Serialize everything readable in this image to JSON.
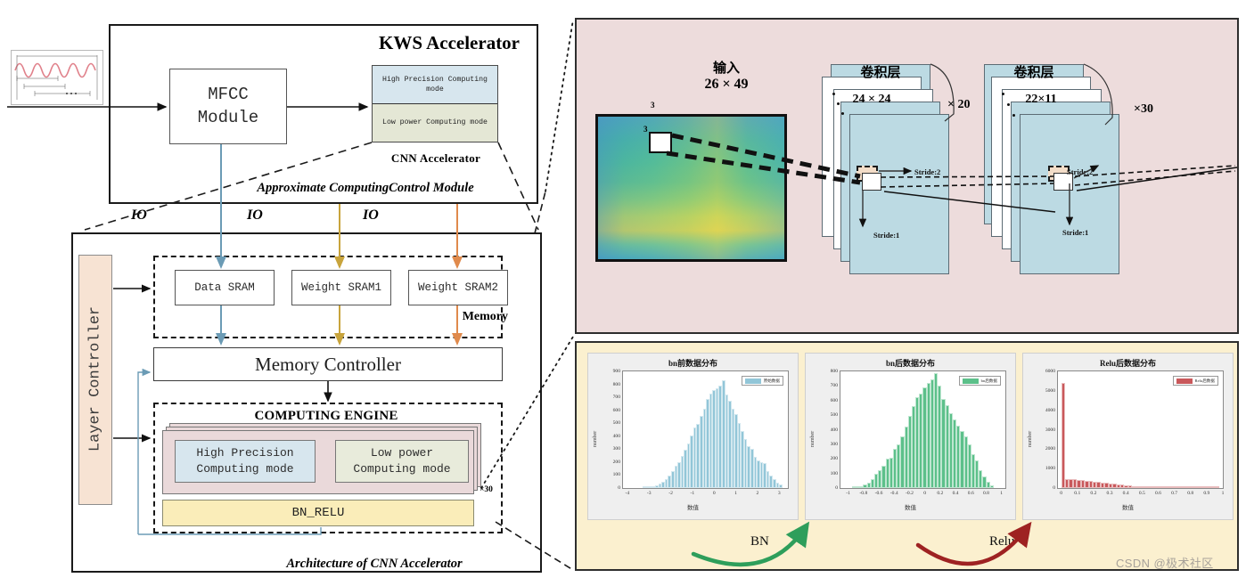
{
  "left_panel": {
    "kws_title": "KWS Accelerator",
    "mfcc_line1": "MFCC",
    "mfcc_line2": "Module",
    "cnn_high_precision": "High Precision Computing mode",
    "cnn_low_power": "Low power Computing mode",
    "cnn_accelerator_label": "CNN  Accelerator",
    "approx_label": "Approximate ComputingControl Module",
    "waveform_icon": "audio-waveform-framing-icon"
  },
  "io_labels": [
    "IO",
    "IO",
    "IO"
  ],
  "io_colors": [
    "#6b9bb5",
    "#c8a43c",
    "#e08a4c"
  ],
  "architecture": {
    "layer_controller": "Layer Controller",
    "memory_label": "Memory",
    "srams": [
      "Data SRAM",
      "Weight SRAM1",
      "Weight SRAM2"
    ],
    "memory_controller": "Memory Controller",
    "engine_title": "COMPUTING ENGINE",
    "mode_high_precision_l1": "High Precision",
    "mode_high_precision_l2": "Computing mode",
    "mode_low_power_l1": "Low power",
    "mode_low_power_l2": "Computing mode",
    "bn_relu": "BN_RELU",
    "engine_multiplier": "×30",
    "arch_label": "Architecture of CNN Accelerator"
  },
  "network": {
    "input_title": "输入",
    "input_dims": "26 × 49",
    "input_depth_top": "3",
    "input_depth_inner": "3",
    "conv1": {
      "title": "卷积层",
      "dims": "24 × 24",
      "stride_h": "Stride:2",
      "stride_v": "Stride:1",
      "multiplier": "× 20"
    },
    "conv2": {
      "title": "卷积层",
      "dims": "22×11",
      "stride_h": "Stride:2",
      "stride_v": "Stride:1",
      "multiplier": "×30"
    }
  },
  "transitions": {
    "bn": "BN",
    "relu": "Relu"
  },
  "watermark": "CSDN @极术社区",
  "chart_data": [
    {
      "type": "bar",
      "title": "bn前数据分布",
      "xlabel": "数值",
      "ylabel": "number",
      "ylim": [
        0,
        900
      ],
      "yticks": [
        0,
        100,
        200,
        300,
        400,
        500,
        600,
        700,
        800,
        900
      ],
      "xticks": [
        -4,
        -3,
        -2,
        -1,
        0,
        1,
        2,
        3
      ],
      "xlim": [
        -4.2,
        3.4
      ],
      "legend": [
        "原始数据"
      ],
      "color": "#92c6d8",
      "grid": false,
      "legend_position": "top-right",
      "categories": [
        -3.3,
        -3.15,
        -3.0,
        -2.85,
        -2.7,
        -2.55,
        -2.4,
        -2.25,
        -2.1,
        -1.95,
        -1.8,
        -1.65,
        -1.5,
        -1.35,
        -1.2,
        -1.05,
        -0.9,
        -0.75,
        -0.6,
        -0.45,
        -0.3,
        -0.15,
        0.0,
        0.15,
        0.3,
        0.45,
        0.6,
        0.75,
        0.9,
        1.05,
        1.2,
        1.35,
        1.5,
        1.65,
        1.8,
        1.95,
        2.1,
        2.25,
        2.4,
        2.55,
        2.7,
        2.85,
        3.0,
        3.15
      ],
      "values": [
        2,
        4,
        8,
        14,
        22,
        34,
        48,
        70,
        95,
        130,
        172,
        200,
        248,
        297,
        345,
        404,
        466,
        498,
        560,
        612,
        684,
        730,
        755,
        773,
        790,
        828,
        720,
        672,
        612,
        570,
        500,
        440,
        375,
        322,
        300,
        240,
        210,
        196,
        190,
        128,
        98,
        70,
        42,
        28
      ]
    },
    {
      "type": "bar",
      "title": "bn后数据分布",
      "xlabel": "数值",
      "ylabel": "number",
      "ylim": [
        0,
        800
      ],
      "yticks": [
        0,
        100,
        200,
        300,
        400,
        500,
        600,
        700,
        800
      ],
      "xticks": [
        -1,
        -0.8,
        -0.6,
        -0.4,
        -0.2,
        0,
        0.2,
        0.4,
        0.6,
        0.8,
        1
      ],
      "xlim": [
        -1.1,
        1.05
      ],
      "legend": [
        "bn后数据"
      ],
      "color": "#5cc08a",
      "grid": false,
      "legend_position": "top-right",
      "categories": [
        -0.95,
        -0.9,
        -0.85,
        -0.8,
        -0.75,
        -0.7,
        -0.65,
        -0.6,
        -0.55,
        -0.5,
        -0.45,
        -0.4,
        -0.35,
        -0.3,
        -0.25,
        -0.2,
        -0.15,
        -0.1,
        -0.05,
        0.0,
        0.05,
        0.1,
        0.15,
        0.2,
        0.25,
        0.3,
        0.35,
        0.4,
        0.45,
        0.5,
        0.55,
        0.6,
        0.65,
        0.7,
        0.75,
        0.8,
        0.85,
        0.9
      ],
      "values": [
        3,
        6,
        12,
        22,
        38,
        62,
        96,
        120,
        150,
        200,
        210,
        270,
        302,
        352,
        420,
        495,
        560,
        620,
        650,
        692,
        718,
        748,
        785,
        700,
        610,
        570,
        512,
        470,
        430,
        390,
        352,
        300,
        230,
        190,
        120,
        80,
        40,
        18
      ]
    },
    {
      "type": "bar",
      "title": "Relu后数据分布",
      "xlabel": "数值",
      "ylabel": "number",
      "ylim": [
        0,
        6000
      ],
      "yticks": [
        0,
        1000,
        2000,
        3000,
        4000,
        5000,
        6000
      ],
      "xticks": [
        0,
        0.1,
        0.2,
        0.3,
        0.4,
        0.5,
        0.6,
        0.7,
        0.8,
        0.9,
        1
      ],
      "xlim": [
        -0.02,
        1.0
      ],
      "legend": [
        "Relu后数据"
      ],
      "color": "#c9585b",
      "grid": false,
      "legend_position": "top-right",
      "categories": [
        0.0,
        0.025,
        0.05,
        0.075,
        0.1,
        0.125,
        0.15,
        0.175,
        0.2,
        0.225,
        0.25,
        0.275,
        0.3,
        0.325,
        0.35,
        0.375,
        0.4,
        0.425,
        0.45,
        0.475,
        0.5,
        0.525,
        0.55,
        0.575,
        0.6,
        0.625,
        0.65,
        0.675,
        0.7,
        0.725,
        0.75,
        0.775,
        0.8,
        0.825,
        0.85,
        0.875,
        0.9,
        0.925,
        0.95,
        0.975
      ],
      "values": [
        5400,
        450,
        460,
        450,
        430,
        400,
        380,
        350,
        320,
        300,
        280,
        260,
        240,
        220,
        190,
        170,
        150,
        120,
        100,
        90,
        80,
        60,
        50,
        40,
        35,
        18,
        10,
        6,
        4,
        3,
        2,
        2,
        1,
        1,
        1,
        1,
        1,
        0,
        0,
        0
      ]
    }
  ]
}
